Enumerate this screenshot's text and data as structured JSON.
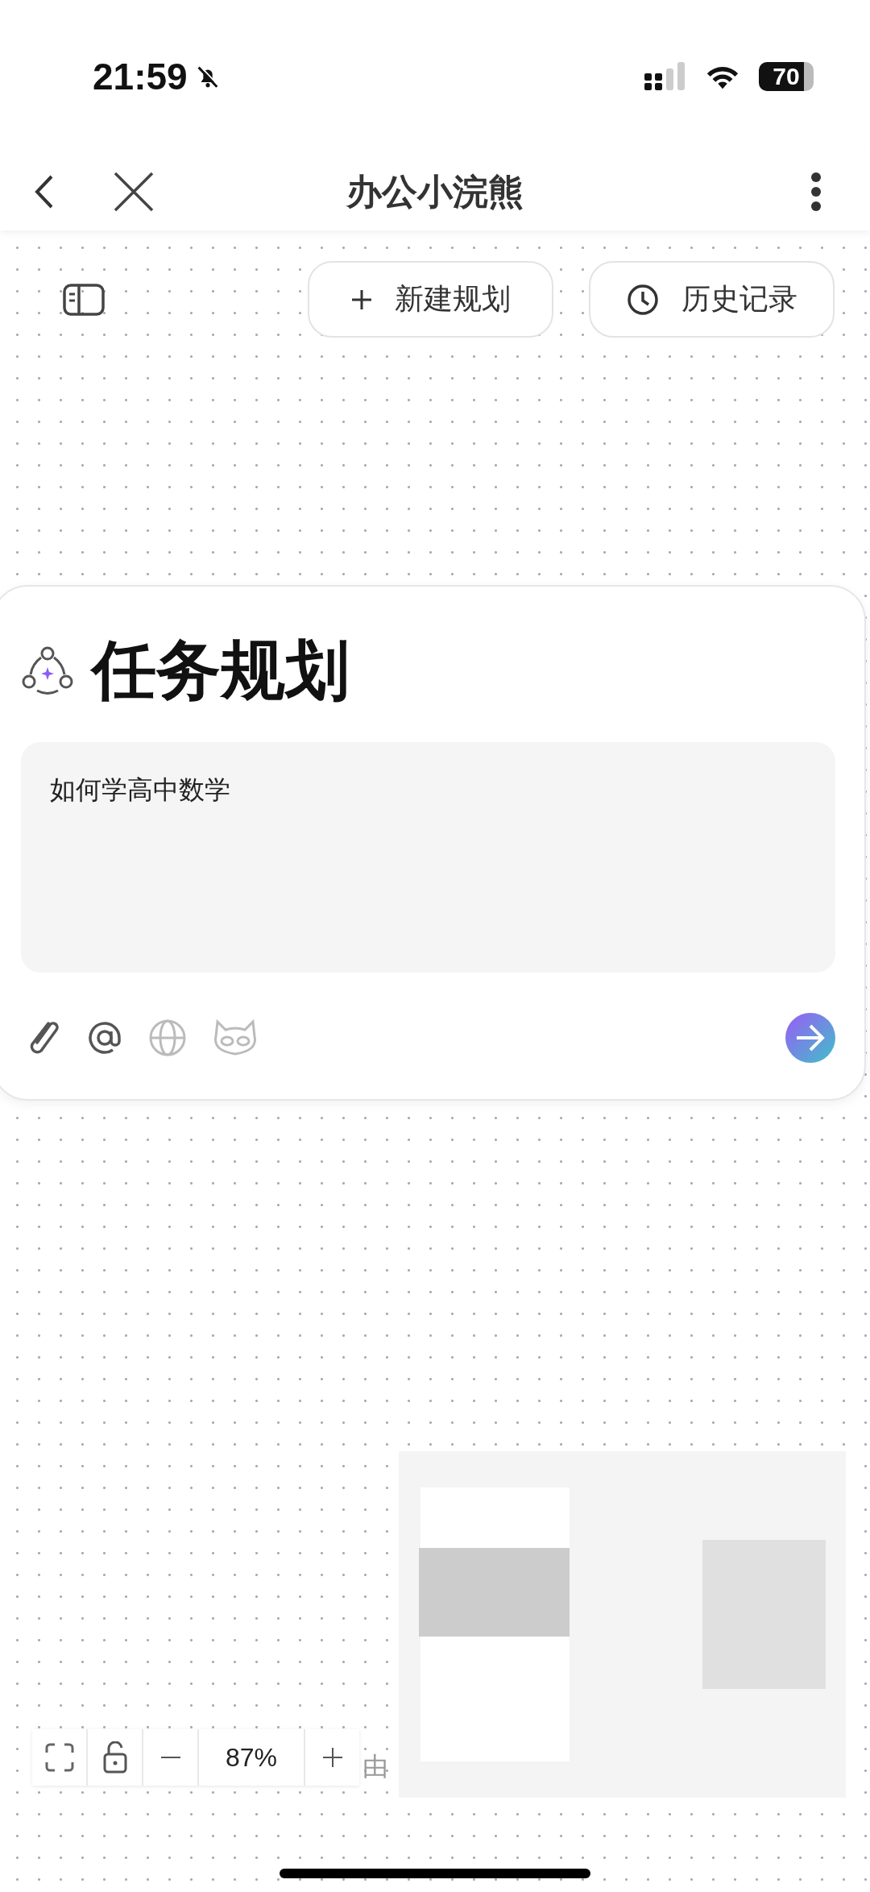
{
  "status_bar": {
    "time": "21:59",
    "battery": "70"
  },
  "nav": {
    "title": "办公小浣熊"
  },
  "actions": [
    {
      "kind": "new",
      "label": "新建规划"
    },
    {
      "kind": "history",
      "label": "历史记录"
    }
  ],
  "card": {
    "title": "任务规划",
    "input": {
      "value": "如何学高中数学"
    },
    "tools": [
      {
        "kind": "attach",
        "on": true
      },
      {
        "kind": "mention",
        "on": true
      },
      {
        "kind": "web",
        "on": false
      },
      {
        "kind": "raccoon",
        "on": false
      }
    ]
  },
  "canvas_text": "由",
  "zoom_bar": {
    "zoom": "87%"
  }
}
